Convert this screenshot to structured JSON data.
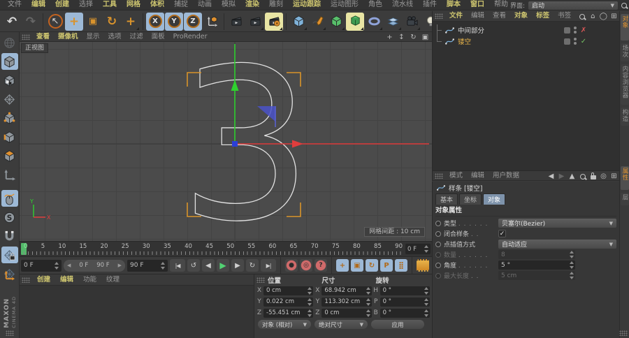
{
  "window": {
    "interface_label": "界面:",
    "interface_value": "启动"
  },
  "colors": {
    "menu_active": "#cdc56f",
    "accent_orange": "#e0912f",
    "axis_green": "#2fd12f",
    "axis_red": "#e03d3d",
    "axis_blue": "#2b3fd6",
    "sel_blue_bg": "#9db9d6",
    "sel_yellow_bg": "#e9e5a4",
    "obj_selected": "#e8b44a",
    "check_green": "#74c163",
    "cross_red": "#dd5858",
    "tab_active_bg": "#7e93ab",
    "vtab_active": "#e5952f"
  },
  "menubar": {
    "items": [
      {
        "label": "文件",
        "active": false
      },
      {
        "label": "编辑",
        "active": true
      },
      {
        "label": "创建",
        "active": true
      },
      {
        "label": "选择",
        "active": false
      },
      {
        "label": "工具",
        "active": true
      },
      {
        "label": "网格",
        "active": true
      },
      {
        "label": "体积",
        "active": true
      },
      {
        "label": "捕捉",
        "active": false
      },
      {
        "label": "动画",
        "active": false
      },
      {
        "label": "模拟",
        "active": false
      },
      {
        "label": "渲染",
        "active": true
      },
      {
        "label": "雕刻",
        "active": false
      },
      {
        "label": "运动跟踪",
        "active": true
      },
      {
        "label": "运动图形",
        "active": false
      },
      {
        "label": "角色",
        "active": false
      },
      {
        "label": "流水线",
        "active": false
      },
      {
        "label": "插件",
        "active": false
      },
      {
        "label": "脚本",
        "active": true
      },
      {
        "label": "窗口",
        "active": true
      },
      {
        "label": "帮助",
        "active": false
      }
    ]
  },
  "toolbar": {
    "icons": [
      {
        "name": "undo-icon",
        "glyph": "↶",
        "cls": "big"
      },
      {
        "name": "redo-icon",
        "glyph": "↷",
        "cls": "big dim"
      },
      {
        "name": "sep"
      },
      {
        "name": "live-selection-icon",
        "glyph": "↖",
        "cls": "ring"
      },
      {
        "name": "move-tool-icon",
        "glyph": "+",
        "cls": "org big on-blue"
      },
      {
        "name": "scale-tool-icon",
        "glyph": "▣",
        "cls": "org"
      },
      {
        "name": "rotate-tool-icon",
        "glyph": "↻",
        "cls": "org big"
      },
      {
        "name": "last-tool-icon",
        "glyph": "+",
        "cls": "org big dd"
      },
      {
        "name": "sep"
      },
      {
        "name": "x-axis-lock-icon",
        "glyph": "X",
        "cls": "circ on-blue"
      },
      {
        "name": "y-axis-lock-icon",
        "glyph": "Y",
        "cls": "circ on-blue"
      },
      {
        "name": "z-axis-lock-icon",
        "glyph": "Z",
        "cls": "circ on-blue"
      },
      {
        "name": "coord-system-icon",
        "sym": "s-axiscube",
        "cls": ""
      },
      {
        "name": "sep"
      },
      {
        "name": "render-view-icon",
        "sym": "s-clap",
        "cls": ""
      },
      {
        "name": "render-picture-viewer-icon",
        "sym": "s-clap",
        "cls": "dd"
      },
      {
        "name": "render-settings-icon",
        "sym": "s-clapg",
        "cls": "on-yellow dd"
      },
      {
        "name": "sep"
      },
      {
        "name": "add-primitive-cube-icon",
        "sym": "s-cube",
        "cls": "c-blue dd"
      },
      {
        "name": "spline-pen-icon",
        "sym": "s-pen",
        "cls": "dd"
      },
      {
        "name": "generators-icon",
        "sym": "s-cube",
        "cls": "c-green dd"
      },
      {
        "name": "modeling-tools-icon",
        "sym": "s-extrude",
        "cls": "on-yellow dd"
      },
      {
        "name": "deformers-icon",
        "sym": "s-torus",
        "cls": "dd"
      },
      {
        "name": "environment-icon",
        "sym": "s-floor",
        "cls": "dd"
      },
      {
        "name": "camera-icon",
        "sym": "s-camera",
        "cls": "dd"
      },
      {
        "name": "light-icon",
        "sym": "s-bulb",
        "cls": "dd"
      }
    ]
  },
  "left_toolbar": {
    "icons": [
      {
        "name": "convert-object-icon",
        "sym": "s-globe",
        "cls": "dim"
      },
      {
        "name": "model-mode-icon",
        "sym": "s-cube",
        "cls": "on-blue c-gray"
      },
      {
        "name": "texture-mode-icon",
        "sym": "s-cubetex",
        "cls": "c-gray"
      },
      {
        "name": "workplane-mode-icon",
        "sym": "s-grid",
        "cls": "c-org"
      },
      {
        "name": "points-mode-icon",
        "sym": "s-cubepts",
        "cls": "c-gray"
      },
      {
        "name": "edges-mode-icon",
        "sym": "s-cubeedge",
        "cls": "c-gray"
      },
      {
        "name": "polygons-mode-icon",
        "sym": "s-cubepoly",
        "cls": "c-gray"
      },
      {
        "name": "axis-mode-icon",
        "sym": "s-axis",
        "cls": "c-org"
      },
      {
        "name": "gap"
      },
      {
        "name": "tweak-mode-icon",
        "sym": "s-mouse",
        "cls": "on-blue"
      },
      {
        "name": "soft-selection-icon",
        "sym": "s-soft",
        "cls": ""
      },
      {
        "name": "snap-icon",
        "sym": "s-magnet",
        "cls": "c-org"
      },
      {
        "name": "workplane-lock-icon",
        "sym": "s-gridlock",
        "cls": "on-blue"
      },
      {
        "name": "planar-workplane-icon",
        "sym": "s-gridaxis",
        "cls": ""
      }
    ]
  },
  "viewport": {
    "menu": [
      {
        "label": "查看",
        "active": true
      },
      {
        "label": "摄像机",
        "active": true
      },
      {
        "label": "显示",
        "active": false
      },
      {
        "label": "选项",
        "active": false
      },
      {
        "label": "过滤",
        "active": false
      },
      {
        "label": "面板",
        "active": false
      },
      {
        "label": "ProRender",
        "active": false
      }
    ],
    "icons": [
      {
        "name": "pan-view-icon",
        "glyph": "+"
      },
      {
        "name": "zoom-view-icon",
        "glyph": "↕"
      },
      {
        "name": "rotate-view-icon",
        "glyph": "↻"
      },
      {
        "name": "toggle-views-icon",
        "glyph": "▣"
      }
    ],
    "view_label": "正视图",
    "grid_label": "网格间距 : 10 cm",
    "axis_y_label": "Y",
    "axis_x_label": "X"
  },
  "timeline": {
    "ticks": [
      "0",
      "5",
      "10",
      "15",
      "20",
      "25",
      "30",
      "35",
      "40",
      "45",
      "50",
      "55",
      "60",
      "65",
      "70",
      "75",
      "80",
      "85",
      "90"
    ],
    "ruler_field": "0 F",
    "current": "0 F",
    "range_start": "0 F",
    "range_end": "90 F",
    "end": "90 F",
    "transport": [
      {
        "name": "goto-start-icon",
        "glyph": "|◀",
        "cls": "wide"
      },
      {
        "name": "prev-key-icon",
        "glyph": "↺",
        "cls": ""
      },
      {
        "name": "prev-frame-icon",
        "glyph": "◀",
        "cls": ""
      },
      {
        "name": "play-icon",
        "glyph": "▶",
        "cls": "green"
      },
      {
        "name": "next-frame-icon",
        "glyph": "▶",
        "cls": ""
      },
      {
        "name": "next-key-icon",
        "glyph": "↻",
        "cls": ""
      },
      {
        "name": "goto-end-icon",
        "glyph": "▶|",
        "cls": "wide"
      },
      {
        "name": "sep"
      },
      {
        "name": "record-keyframe-icon",
        "glyph": "●",
        "cls": "red"
      },
      {
        "name": "autokey-icon",
        "glyph": "◎",
        "cls": "red"
      },
      {
        "name": "keyframe-options-icon",
        "glyph": "?",
        "cls": "red"
      },
      {
        "name": "sep"
      },
      {
        "name": "key-position-icon",
        "glyph": "+",
        "cls": "blue"
      },
      {
        "name": "key-scale-icon",
        "glyph": "▣",
        "cls": "blue"
      },
      {
        "name": "key-rotation-icon",
        "glyph": "↻",
        "cls": "blue"
      },
      {
        "name": "key-parameter-icon",
        "glyph": "P",
        "cls": "blue"
      },
      {
        "name": "key-pla-icon",
        "glyph": "⣿",
        "cls": "blue"
      },
      {
        "name": "sep"
      },
      {
        "name": "motion-system-icon",
        "glyph": "",
        "cls": "film"
      }
    ]
  },
  "materials": {
    "menu": [
      {
        "label": "创建",
        "active": true
      },
      {
        "label": "编辑",
        "active": true
      },
      {
        "label": "功能",
        "active": false
      },
      {
        "label": "纹理",
        "active": false
      }
    ]
  },
  "coordinates": {
    "headers": [
      "位置",
      "尺寸",
      "旋转"
    ],
    "rows": [
      {
        "pl": "X",
        "pv": "0 cm",
        "sl": "X",
        "sv": "68.942 cm",
        "rl": "H",
        "rv": "0 °"
      },
      {
        "pl": "Y",
        "pv": "0.022 cm",
        "sl": "Y",
        "sv": "113.302 cm",
        "rl": "P",
        "rv": "0 °"
      },
      {
        "pl": "Z",
        "pv": "-55.451 cm",
        "sl": "Z",
        "sv": "0 cm",
        "rl": "B",
        "rv": "0 °"
      }
    ],
    "mode_position": "对象 (相对)",
    "mode_size": "绝对尺寸",
    "apply_label": "应用"
  },
  "object_manager": {
    "menu": [
      {
        "label": "文件",
        "active": true
      },
      {
        "label": "编辑",
        "active": false
      },
      {
        "label": "查看",
        "active": false
      },
      {
        "label": "对象",
        "active": true
      },
      {
        "label": "标签",
        "active": true
      },
      {
        "label": "书签",
        "active": false
      }
    ],
    "icons": [
      {
        "name": "search-icon",
        "css": "mag"
      },
      {
        "name": "home-icon",
        "glyph": "⌂"
      },
      {
        "name": "filter-icon",
        "glyph": "◯"
      },
      {
        "name": "add-panel-icon",
        "glyph": "⊞"
      }
    ],
    "objects": [
      {
        "name": "中间部分",
        "selected": false,
        "state_glyph": "✗"
      },
      {
        "name": "镂空",
        "selected": true,
        "state_glyph": "✓"
      }
    ]
  },
  "attributes": {
    "menu": [
      {
        "label": "模式",
        "active": false
      },
      {
        "label": "编辑",
        "active": false
      },
      {
        "label": "用户数据",
        "active": false
      }
    ],
    "icons": [
      {
        "name": "back-icon",
        "glyph": "◀"
      },
      {
        "name": "forward-icon",
        "glyph": "▶",
        "cls": "dim"
      },
      {
        "name": "up-icon",
        "glyph": "▲"
      },
      {
        "name": "search-icon",
        "css": "mag"
      },
      {
        "name": "lock-icon",
        "css": "lock"
      },
      {
        "name": "focus-icon",
        "glyph": "◎"
      },
      {
        "name": "add-tab-icon",
        "glyph": "⊞"
      }
    ],
    "title": "样条 [镂空]",
    "tabs": [
      {
        "label": "基本",
        "active": false
      },
      {
        "label": "坐标",
        "active": false
      },
      {
        "label": "对象",
        "active": true
      }
    ],
    "section": "对象属性",
    "rows": [
      {
        "label": "类型",
        "dots": ". . . . . .",
        "control": "dropdown",
        "value": "贝塞尔(Bezier)",
        "enabled": true
      },
      {
        "label": "闭合样条",
        "dots": ". .",
        "control": "checkbox",
        "value": "✓",
        "enabled": true
      },
      {
        "label": "点插值方式",
        "dots": "",
        "control": "dropdown",
        "value": "自动适应",
        "enabled": true
      },
      {
        "label": "数量",
        "dots": ". . . . . .",
        "control": "field",
        "value": "8",
        "enabled": false
      },
      {
        "label": "角度",
        "dots": ". . . . . .",
        "control": "field",
        "value": "5 °",
        "enabled": true
      },
      {
        "label": "最大长度",
        "dots": ". .",
        "control": "field",
        "value": "5 cm",
        "enabled": false
      }
    ]
  },
  "right_tabs": {
    "top": [
      {
        "label": "对象",
        "active": true
      },
      {
        "label": "场次",
        "active": false
      },
      {
        "label": "内容浏览器",
        "active": false
      },
      {
        "label": "构造",
        "active": false
      }
    ],
    "bottom": [
      {
        "label": "属性",
        "active": true
      },
      {
        "label": "层",
        "active": false
      }
    ]
  },
  "branding": {
    "maxon": "MAXON",
    "cinema": "CINEMA 4D"
  }
}
